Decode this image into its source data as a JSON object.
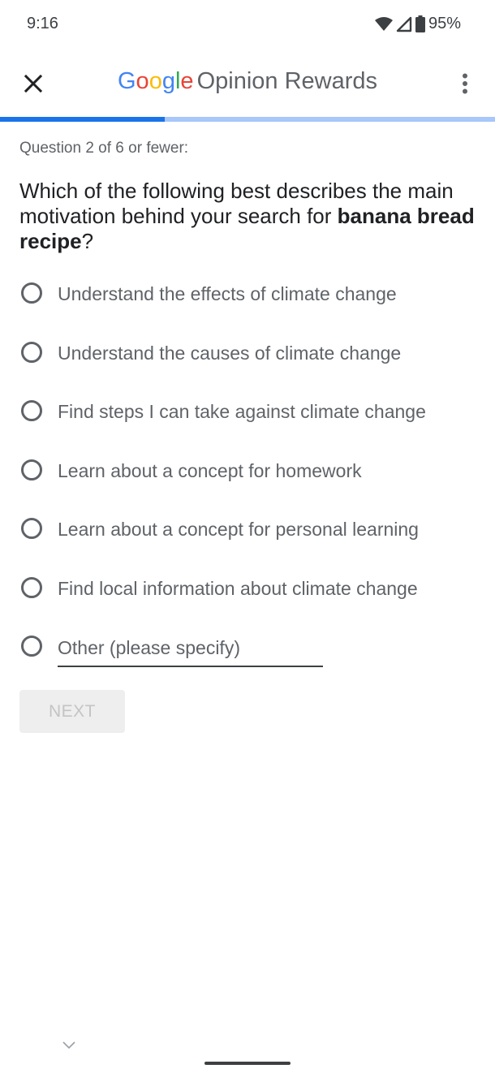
{
  "status_bar": {
    "time": "9:16",
    "battery": "95%",
    "icons": [
      "wifi-icon",
      "cell-signal-icon",
      "battery-icon"
    ]
  },
  "app_bar": {
    "google_letters": [
      {
        "ch": "G",
        "color": "#4285F4"
      },
      {
        "ch": "o",
        "color": "#EA4335"
      },
      {
        "ch": "o",
        "color": "#FBBC05"
      },
      {
        "ch": "g",
        "color": "#4285F4"
      },
      {
        "ch": "l",
        "color": "#34A853"
      },
      {
        "ch": "e",
        "color": "#EA4335"
      }
    ],
    "product_name": "Opinion Rewards",
    "close_icon": "close-icon",
    "more_icon": "more-vert-icon"
  },
  "progress": {
    "current": 2,
    "total": 6,
    "fraction": 0.333,
    "fill_color": "#1a73e8",
    "track_color": "#a8c7fa"
  },
  "question": {
    "count_label": "Question 2 of 6 or fewer:",
    "text_before": "Which of the following best describes the main motivation behind your search for ",
    "text_bold": "banana bread recipe",
    "text_after": "?"
  },
  "options": [
    {
      "label": "Understand the effects of climate change"
    },
    {
      "label": "Understand the causes of climate change"
    },
    {
      "label": "Find steps I can take against climate change"
    },
    {
      "label": "Learn about a concept for homework"
    },
    {
      "label": "Learn about a concept for personal learning"
    },
    {
      "label": "Find local information about climate change"
    }
  ],
  "other_option": {
    "placeholder": "Other (please specify)",
    "value": ""
  },
  "next_button": {
    "label": "NEXT",
    "enabled": false
  },
  "navigation": {
    "chevron_icon": "chevron-down-icon"
  }
}
